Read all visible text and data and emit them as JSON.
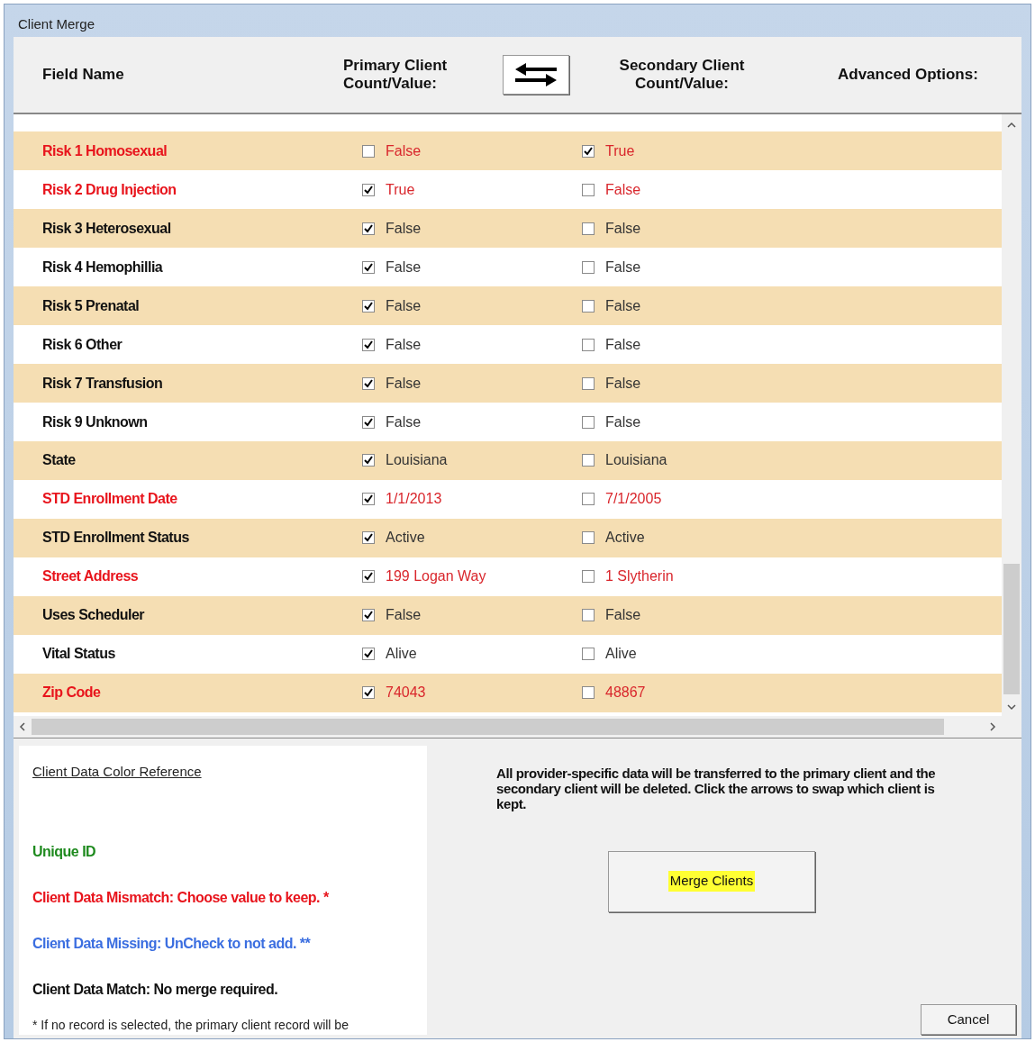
{
  "window": {
    "title": "Client Merge"
  },
  "header": {
    "field_name": "Field Name",
    "primary": "Primary Client Count/Value:",
    "secondary": "Secondary Client Count/Value:",
    "advanced": "Advanced Options:"
  },
  "rows": [
    {
      "field": "Risk 1 Homosexual",
      "kind": "mismatch",
      "primary": {
        "checked": false,
        "value": "False"
      },
      "secondary": {
        "checked": true,
        "value": "True"
      }
    },
    {
      "field": "Risk 2 Drug Injection",
      "kind": "mismatch",
      "primary": {
        "checked": true,
        "value": "True"
      },
      "secondary": {
        "checked": false,
        "value": "False"
      }
    },
    {
      "field": "Risk 3 Heterosexual",
      "kind": "match",
      "primary": {
        "checked": true,
        "value": "False"
      },
      "secondary": {
        "checked": false,
        "value": "False"
      }
    },
    {
      "field": "Risk 4 Hemophillia",
      "kind": "match",
      "primary": {
        "checked": true,
        "value": "False"
      },
      "secondary": {
        "checked": false,
        "value": "False"
      }
    },
    {
      "field": "Risk 5 Prenatal",
      "kind": "match",
      "primary": {
        "checked": true,
        "value": "False"
      },
      "secondary": {
        "checked": false,
        "value": "False"
      }
    },
    {
      "field": "Risk 6 Other",
      "kind": "match",
      "primary": {
        "checked": true,
        "value": "False"
      },
      "secondary": {
        "checked": false,
        "value": "False"
      }
    },
    {
      "field": "Risk 7 Transfusion",
      "kind": "match",
      "primary": {
        "checked": true,
        "value": "False"
      },
      "secondary": {
        "checked": false,
        "value": "False"
      }
    },
    {
      "field": "Risk 9 Unknown",
      "kind": "match",
      "primary": {
        "checked": true,
        "value": "False"
      },
      "secondary": {
        "checked": false,
        "value": "False"
      }
    },
    {
      "field": "State",
      "kind": "match",
      "primary": {
        "checked": true,
        "value": "Louisiana"
      },
      "secondary": {
        "checked": false,
        "value": "Louisiana"
      }
    },
    {
      "field": "STD Enrollment Date",
      "kind": "mismatch",
      "primary": {
        "checked": true,
        "value": "1/1/2013"
      },
      "secondary": {
        "checked": false,
        "value": "7/1/2005"
      }
    },
    {
      "field": "STD Enrollment Status",
      "kind": "match",
      "primary": {
        "checked": true,
        "value": "Active"
      },
      "secondary": {
        "checked": false,
        "value": "Active"
      }
    },
    {
      "field": "Street Address",
      "kind": "mismatch",
      "primary": {
        "checked": true,
        "value": "199 Logan Way"
      },
      "secondary": {
        "checked": false,
        "value": "1 Slytherin"
      }
    },
    {
      "field": "Uses Scheduler",
      "kind": "match",
      "primary": {
        "checked": true,
        "value": "False"
      },
      "secondary": {
        "checked": false,
        "value": "False"
      }
    },
    {
      "field": "Vital Status",
      "kind": "match",
      "primary": {
        "checked": true,
        "value": "Alive"
      },
      "secondary": {
        "checked": false,
        "value": "Alive"
      }
    },
    {
      "field": "Zip Code",
      "kind": "mismatch",
      "primary": {
        "checked": true,
        "value": "74043"
      },
      "secondary": {
        "checked": false,
        "value": "48867"
      }
    }
  ],
  "legend": {
    "title": "Client Data Color Reference",
    "items": [
      {
        "kind": "unique",
        "text": "Unique ID"
      },
      {
        "kind": "mismatch",
        "text": "Client Data Mismatch: Choose value to keep. *"
      },
      {
        "kind": "missing",
        "text": "Client Data Missing: UnCheck to not add. **"
      },
      {
        "kind": "match",
        "text": "Client Data Match: No merge required."
      }
    ],
    "footnote": "* If no record is selected, the primary client record will be"
  },
  "info": "All provider-specific data will be transferred to the primary client and the secondary client will be deleted. Click the arrows to swap which client is kept.",
  "merge_button": {
    "label": "Merge Clients",
    "highlighted": true
  },
  "cancel_button": "Cancel"
}
